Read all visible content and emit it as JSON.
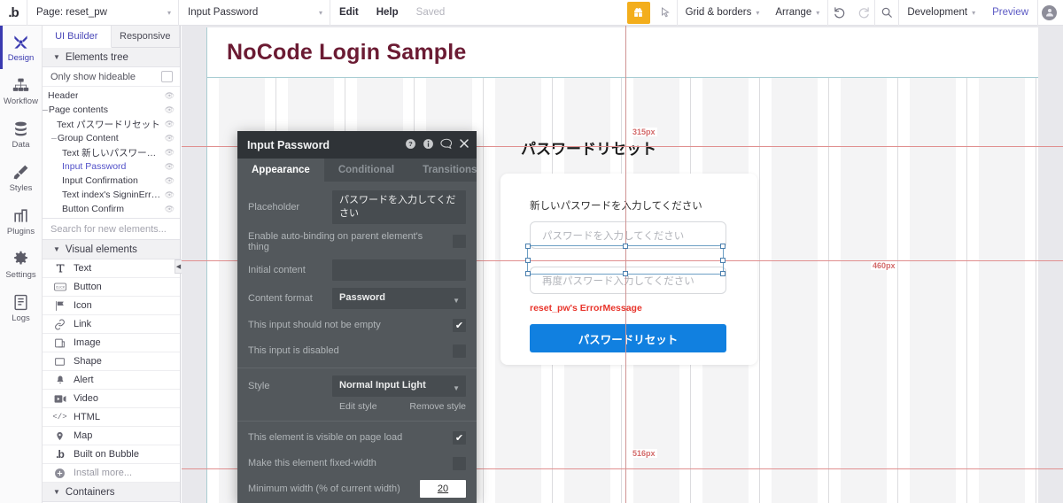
{
  "topbar": {
    "logo": ".b",
    "page_select": {
      "value": "Page: reset_pw",
      "caret": "▾"
    },
    "element_select": {
      "value": "Input Password",
      "caret": "▾"
    },
    "edit_label": "Edit",
    "help_label": "Help",
    "save_status": "Saved",
    "grid_borders": {
      "label": "Grid & borders",
      "caret": "▾"
    },
    "arrange": {
      "label": "Arrange",
      "caret": "▾"
    },
    "undo_icon": "undo-icon",
    "redo_icon": "redo-icon",
    "search_icon": "search-icon",
    "version": {
      "label": "Development",
      "caret": "▾"
    },
    "preview_label": "Preview",
    "gift_icon": "gift-icon",
    "cursor_icon": "cursor-icon",
    "avatar_icon": "avatar-icon"
  },
  "rail": {
    "items": [
      {
        "label": "Design",
        "icon": "design-icon",
        "active": true
      },
      {
        "label": "Workflow",
        "icon": "workflow-icon",
        "active": false
      },
      {
        "label": "Data",
        "icon": "data-icon",
        "active": false
      },
      {
        "label": "Styles",
        "icon": "styles-icon",
        "active": false
      },
      {
        "label": "Plugins",
        "icon": "plugins-icon",
        "active": false
      },
      {
        "label": "Settings",
        "icon": "settings-icon",
        "active": false
      },
      {
        "label": "Logs",
        "icon": "logs-icon",
        "active": false
      }
    ]
  },
  "panel": {
    "tabs": [
      {
        "label": "UI Builder",
        "active": true
      },
      {
        "label": "Responsive",
        "active": false
      }
    ],
    "elements_tree_title": "Elements tree",
    "only_show_hideable": "Only show hideable",
    "tree": [
      {
        "label": "Header",
        "indent": 0,
        "prefix": "",
        "selected": false
      },
      {
        "label": "Page contents",
        "indent": 0,
        "prefix": "–",
        "selected": false
      },
      {
        "label": "Text パスワードリセット",
        "indent": 1,
        "prefix": "",
        "selected": false
      },
      {
        "label": "Group Content",
        "indent": 1,
        "prefix": "–",
        "selected": false
      },
      {
        "label": "Text 新しいパスワード...",
        "indent": 2,
        "prefix": "",
        "selected": false
      },
      {
        "label": "Input Password",
        "indent": 2,
        "prefix": "",
        "selected": true
      },
      {
        "label": "Input Confirmation",
        "indent": 2,
        "prefix": "",
        "selected": false
      },
      {
        "label": "Text index's SigninError...",
        "indent": 2,
        "prefix": "",
        "selected": false
      },
      {
        "label": "Button Confirm",
        "indent": 2,
        "prefix": "",
        "selected": false
      }
    ],
    "search_placeholder": "Search for new elements...",
    "visual_elements_title": "Visual elements",
    "elements": [
      {
        "label": "Text",
        "icon": "text-icon",
        "muted": false
      },
      {
        "label": "Button",
        "icon": "button-icon",
        "muted": false
      },
      {
        "label": "Icon",
        "icon": "flag-icon",
        "muted": false
      },
      {
        "label": "Link",
        "icon": "link-icon",
        "muted": false
      },
      {
        "label": "Image",
        "icon": "image-icon",
        "muted": false
      },
      {
        "label": "Shape",
        "icon": "shape-icon",
        "muted": false
      },
      {
        "label": "Alert",
        "icon": "bell-icon",
        "muted": false
      },
      {
        "label": "Video",
        "icon": "video-icon",
        "muted": false
      },
      {
        "label": "HTML",
        "icon": "html-icon",
        "muted": false
      },
      {
        "label": "Map",
        "icon": "map-pin-icon",
        "muted": false
      },
      {
        "label": "Built on Bubble",
        "icon": "bubble-icon",
        "muted": false
      },
      {
        "label": "Install more...",
        "icon": "plus-circle-icon",
        "muted": true
      }
    ],
    "containers_title": "Containers",
    "collapse_icon": "collapse-panel-icon"
  },
  "canvas": {
    "header_title": "NoCode Login Sample",
    "page_heading": "パスワードリセット",
    "field_label": "新しいパスワードを入力してください",
    "input_password_placeholder": "パスワードを入力してください",
    "input_confirmation_placeholder": "再度パスワード入力してください",
    "error_message": "reset_pw's ErrorMessage",
    "submit_button": "パスワードリセット",
    "guides": [
      {
        "label": "315px",
        "axis": "horizontal"
      },
      {
        "label": "460px",
        "axis": "vertical"
      },
      {
        "label": "516px",
        "axis": "horizontal"
      }
    ],
    "accent_color": "#1cb5d8",
    "button_color": "#1180e0",
    "header_color": "#6b1b33",
    "error_color": "#e8342b"
  },
  "property_editor": {
    "title": "Input Password",
    "title_icons": [
      "help-circle-icon",
      "info-icon",
      "comment-icon",
      "close-icon"
    ],
    "tabs": [
      {
        "label": "Appearance",
        "active": true
      },
      {
        "label": "Conditional",
        "active": false
      },
      {
        "label": "Transitions",
        "active": false
      }
    ],
    "placeholder_label": "Placeholder",
    "placeholder_value": "パスワードを入力してください",
    "autobinding_label": "Enable auto-binding on parent element's thing",
    "autobinding_checked": "",
    "initial_content_label": "Initial content",
    "initial_content_value": "",
    "content_format_label": "Content format",
    "content_format_value": "Password",
    "not_empty_label": "This input should not be empty",
    "not_empty_checked": "✔",
    "disabled_label": "This input is disabled",
    "disabled_checked": "",
    "style_label": "Style",
    "style_value": "Normal Input Light",
    "edit_style": "Edit style",
    "remove_style": "Remove style",
    "visible_label": "This element is visible on page load",
    "visible_checked": "✔",
    "fixed_width_label": "Make this element fixed-width",
    "fixed_width_checked": "",
    "min_width_label": "Minimum width (% of current width)",
    "min_width_value": "20"
  }
}
